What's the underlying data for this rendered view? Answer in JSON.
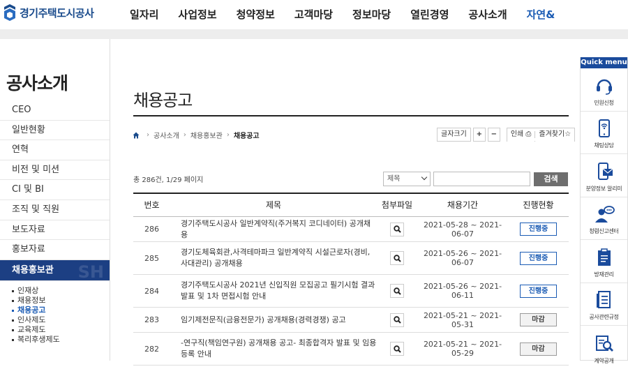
{
  "header": {
    "logo_text": "경기주택도시공사",
    "nav": [
      "일자리",
      "사업정보",
      "청약정보",
      "고객마당",
      "정보마당",
      "열린경영",
      "공사소개",
      "자연&"
    ]
  },
  "sidebar": {
    "title": "공사소개",
    "items": [
      {
        "label": "CEO"
      },
      {
        "label": "일반현황"
      },
      {
        "label": "연혁"
      },
      {
        "label": "비전 및 미션"
      },
      {
        "label": "CI 및 BI"
      },
      {
        "label": "조직 및 직원"
      },
      {
        "label": "보도자료"
      },
      {
        "label": "홍보자료"
      },
      {
        "label": "채용홍보관",
        "active": true
      }
    ],
    "sub_items": [
      {
        "label": "인재상"
      },
      {
        "label": "채용정보"
      },
      {
        "label": "채용공고",
        "active": true
      },
      {
        "label": "인사제도"
      },
      {
        "label": "교육제도"
      },
      {
        "label": "복리후생제도"
      }
    ]
  },
  "main": {
    "title": "채용공고",
    "breadcrumb": [
      "공사소개",
      "채용홍보관",
      "채용공고"
    ],
    "tools": {
      "font_size": "글자크기",
      "plus": "+",
      "minus": "−",
      "print": "인쇄",
      "favorite": "즐겨찾기"
    },
    "count_text": "총 286건, 1/29 페이지",
    "search": {
      "select_value": "제목",
      "query": "",
      "button": "검색"
    },
    "table": {
      "headers": [
        "번호",
        "제목",
        "첨부파일",
        "채용기간",
        "진행현황"
      ],
      "rows": [
        {
          "no": "286",
          "title": "경기주택도시공사 일반계약직(주거복지 코디네이터) 공개채용",
          "period": "2021-05-28 ~ 2021-06-07",
          "status": "진행중",
          "open": true
        },
        {
          "no": "285",
          "title": "경기도체육회관,사격테마파크 일반계약직 시설근로자(경비,사대관리) 공개채용",
          "period": "2021-05-26 ~ 2021-06-07",
          "status": "진행중",
          "open": true
        },
        {
          "no": "284",
          "title": "경기주택도시공사 2021년 신입직원 모집공고 필기시험 결과 발표 및 1차 면접시험 안내",
          "period": "2021-05-26 ~ 2021-06-11",
          "status": "진행중",
          "open": true
        },
        {
          "no": "283",
          "title": "임기제전문직(금융전문가) 공개채용(경력경쟁) 공고",
          "period": "2021-05-21 ~ 2021-05-31",
          "status": "마감",
          "open": false
        },
        {
          "no": "282",
          "title": "-연구직(책임연구원) 공개채용 공고- 최종합격자 발표 및 임용 등록 안내",
          "period": "2021-05-21 ~ 2021-05-29",
          "status": "마감",
          "open": false
        }
      ]
    }
  },
  "quick_menu": {
    "title": "Quick menu",
    "items": [
      {
        "label": "민원신청",
        "icon": "headset-icon"
      },
      {
        "label": "채팅상담",
        "icon": "smartphone-chat-icon"
      },
      {
        "label": "분양정보 알리미",
        "icon": "phone-mail-icon"
      },
      {
        "label": "청렴신고센터",
        "icon": "person-speech-icon"
      },
      {
        "label": "방재관리",
        "icon": "clipboard-icon"
      },
      {
        "label": "공사관련규정",
        "icon": "document-icon"
      },
      {
        "label": "계약공개",
        "icon": "search-document-icon"
      }
    ]
  },
  "colors": {
    "brand": "#1a4b8c",
    "active_nav": "#1c3f83",
    "accent_blue": "#1a5bb4",
    "quick_head": "#1a4b9c"
  }
}
